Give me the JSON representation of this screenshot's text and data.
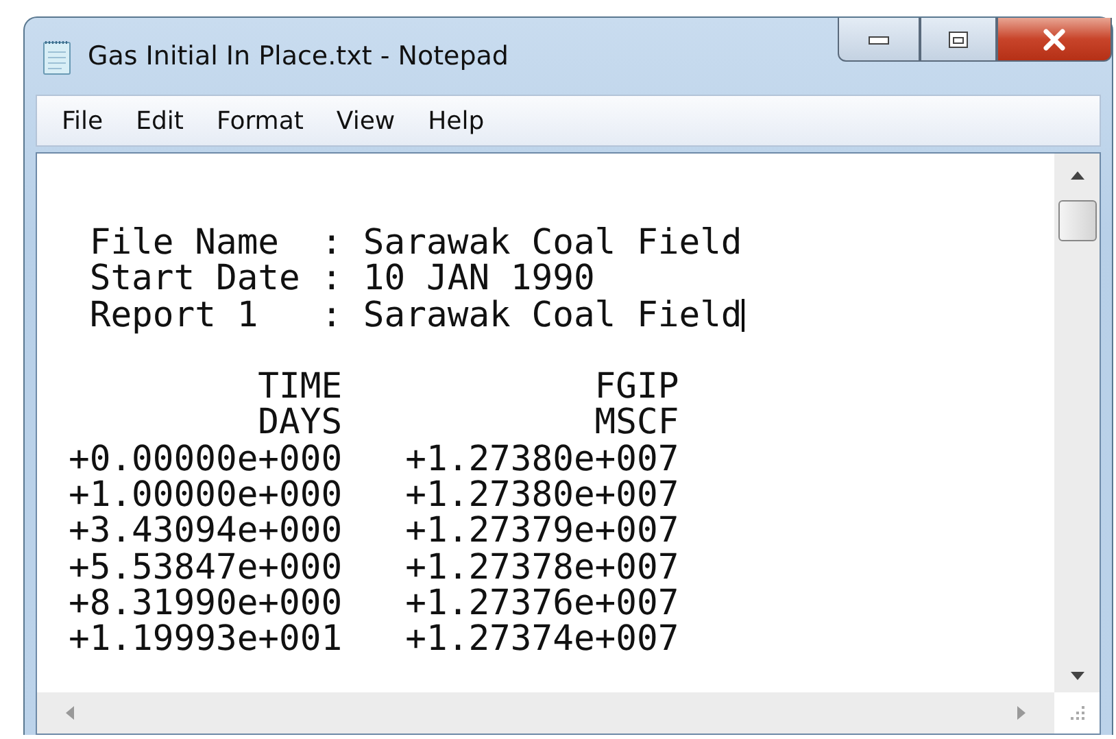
{
  "window": {
    "title": "Gas Initial In Place.txt - Notepad"
  },
  "menu": [
    "File",
    "Edit",
    "Format",
    "View",
    "Help"
  ],
  "editor": {
    "header_lines": [
      " File Name  : Sarawak Coal Field",
      " Start Date : 10 JAN 1990",
      " Report 1   : Sarawak Coal Field"
    ],
    "table_lines": [
      "         TIME            FGIP",
      "         DAYS            MSCF",
      "+0.00000e+000   +1.27380e+007",
      "+1.00000e+000   +1.27380e+007",
      "+3.43094e+000   +1.27379e+007",
      "+5.53847e+000   +1.27378e+007",
      "+8.31990e+000   +1.27376e+007",
      "+1.19993e+001   +1.27374e+007"
    ]
  }
}
